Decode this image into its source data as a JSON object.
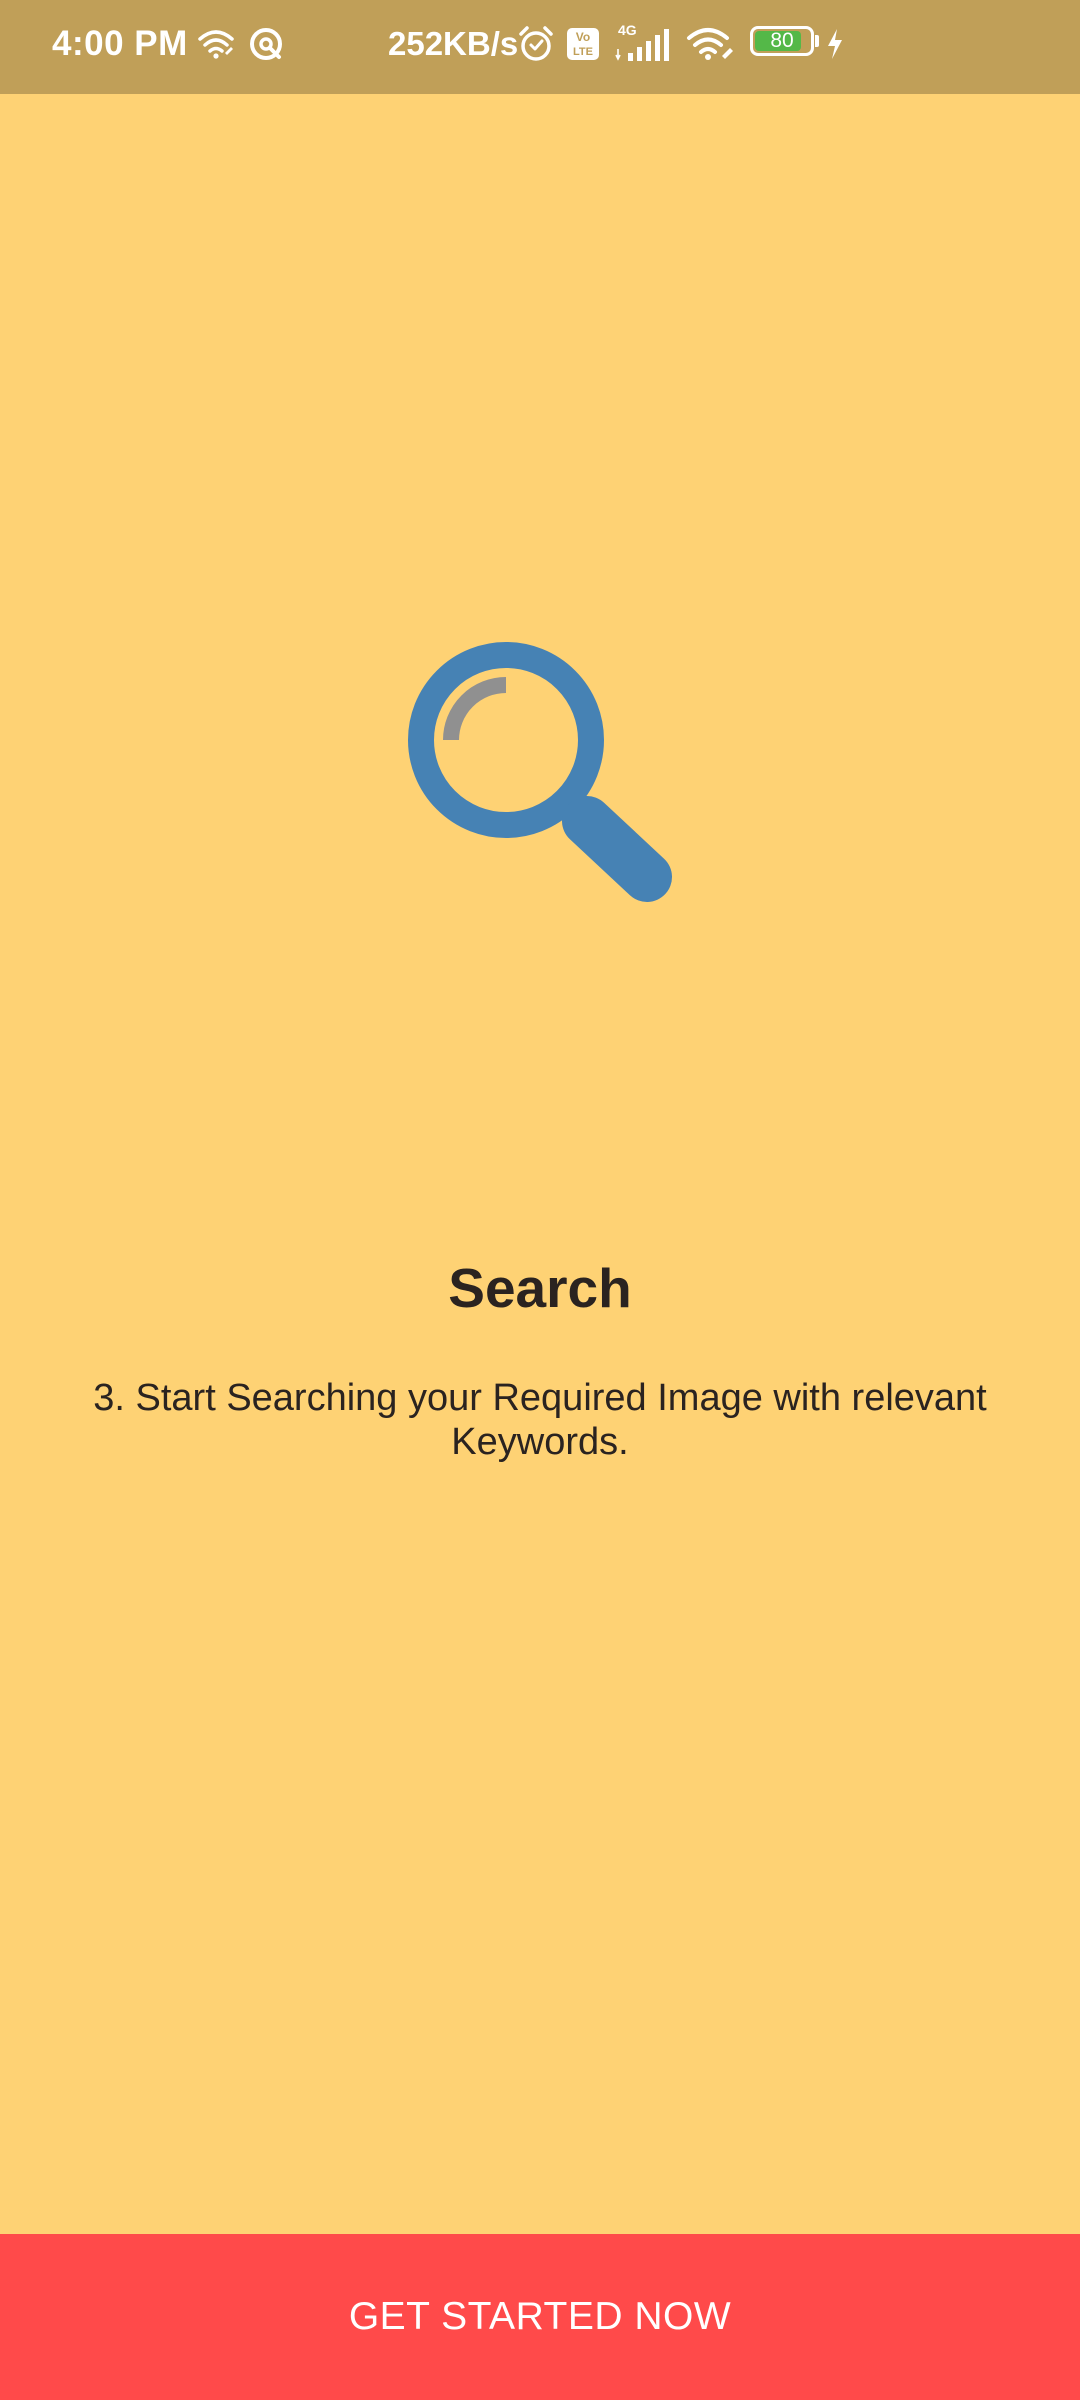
{
  "status_bar": {
    "time": "4:00 PM",
    "network_speed": "252KB/s",
    "volte_badge": "Vo LTE",
    "network_type": "4G",
    "battery_level": "80",
    "icons": [
      "wifi-calling-icon",
      "vpn-icon",
      "alarm-icon",
      "volte-icon",
      "signal-icon",
      "wifi-icon",
      "battery-icon",
      "charging-icon"
    ]
  },
  "onboarding": {
    "icon": "search-icon",
    "title": "Search",
    "description": "3. Start Searching your Required Image with relevant Keywords."
  },
  "cta": {
    "label": "GET STARTED NOW"
  },
  "colors": {
    "status_bar": "#c09f58",
    "background": "#fed274",
    "icon_blue": "#4682b4",
    "icon_highlight": "#909090",
    "text": "#2a2320",
    "cta_background": "#ff4a4a",
    "cta_text": "#ffffff",
    "battery_fill": "#54b848"
  }
}
